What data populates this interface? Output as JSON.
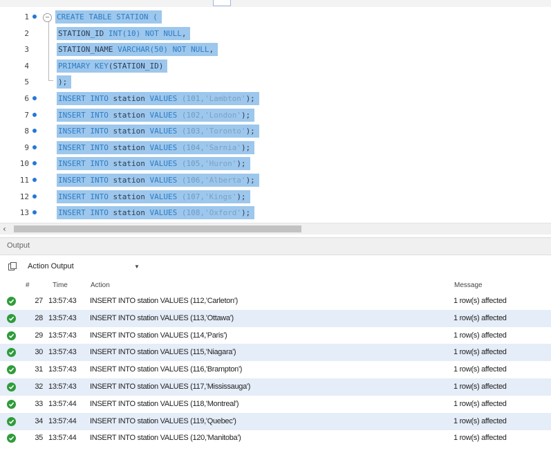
{
  "editor": {
    "lines": [
      {
        "number": "1",
        "breakpoint": true,
        "indent": false,
        "tokens": [
          {
            "t": "CREATE TABLE STATION (",
            "c": "kw"
          }
        ]
      },
      {
        "number": "2",
        "breakpoint": false,
        "indent": true,
        "tokens": [
          {
            "t": "STATION_ID ",
            "c": "plain"
          },
          {
            "t": "INT(10) NOT NULL",
            "c": "kw"
          },
          {
            "t": ",",
            "c": "plain"
          }
        ]
      },
      {
        "number": "3",
        "breakpoint": false,
        "indent": true,
        "tokens": [
          {
            "t": "STATION_NAME ",
            "c": "plain"
          },
          {
            "t": "VARCHAR(50) NOT NULL",
            "c": "kw"
          },
          {
            "t": ",",
            "c": "plain"
          }
        ]
      },
      {
        "number": "4",
        "breakpoint": false,
        "indent": true,
        "tokens": [
          {
            "t": "PRIMARY KEY",
            "c": "kw"
          },
          {
            "t": "(STATION_ID)",
            "c": "plain"
          }
        ]
      },
      {
        "number": "5",
        "breakpoint": false,
        "indent": true,
        "tokens": [
          {
            "t": ");",
            "c": "plain"
          }
        ]
      },
      {
        "number": "6",
        "breakpoint": true,
        "indent": true,
        "tokens": [
          {
            "t": "INSERT INTO ",
            "c": "kw"
          },
          {
            "t": "station ",
            "c": "plain"
          },
          {
            "t": "VALUES ",
            "c": "kw"
          },
          {
            "t": "(101,",
            "c": "num"
          },
          {
            "t": "'Lambton'",
            "c": "str"
          },
          {
            "t": ");",
            "c": "plain"
          }
        ]
      },
      {
        "number": "7",
        "breakpoint": true,
        "indent": true,
        "tokens": [
          {
            "t": "INSERT INTO ",
            "c": "kw"
          },
          {
            "t": "station ",
            "c": "plain"
          },
          {
            "t": "VALUES ",
            "c": "kw"
          },
          {
            "t": "(102,",
            "c": "num"
          },
          {
            "t": "'London'",
            "c": "str"
          },
          {
            "t": ");",
            "c": "plain"
          }
        ]
      },
      {
        "number": "8",
        "breakpoint": true,
        "indent": true,
        "tokens": [
          {
            "t": "INSERT INTO ",
            "c": "kw"
          },
          {
            "t": "station ",
            "c": "plain"
          },
          {
            "t": "VALUES ",
            "c": "kw"
          },
          {
            "t": "(103,",
            "c": "num"
          },
          {
            "t": "'Toronto'",
            "c": "str"
          },
          {
            "t": ");",
            "c": "plain"
          }
        ]
      },
      {
        "number": "9",
        "breakpoint": true,
        "indent": true,
        "tokens": [
          {
            "t": "INSERT INTO ",
            "c": "kw"
          },
          {
            "t": "station ",
            "c": "plain"
          },
          {
            "t": "VALUES ",
            "c": "kw"
          },
          {
            "t": "(104,",
            "c": "num"
          },
          {
            "t": "'Sarnia'",
            "c": "str"
          },
          {
            "t": ");",
            "c": "plain"
          }
        ]
      },
      {
        "number": "10",
        "breakpoint": true,
        "indent": true,
        "tokens": [
          {
            "t": "INSERT INTO ",
            "c": "kw"
          },
          {
            "t": "station ",
            "c": "plain"
          },
          {
            "t": "VALUES ",
            "c": "kw"
          },
          {
            "t": "(105,",
            "c": "num"
          },
          {
            "t": "'Huron'",
            "c": "str"
          },
          {
            "t": ");",
            "c": "plain"
          }
        ]
      },
      {
        "number": "11",
        "breakpoint": true,
        "indent": true,
        "tokens": [
          {
            "t": "INSERT INTO ",
            "c": "kw"
          },
          {
            "t": "station ",
            "c": "plain"
          },
          {
            "t": "VALUES ",
            "c": "kw"
          },
          {
            "t": "(106,",
            "c": "num"
          },
          {
            "t": "'Alberta'",
            "c": "str"
          },
          {
            "t": ");",
            "c": "plain"
          }
        ]
      },
      {
        "number": "12",
        "breakpoint": true,
        "indent": true,
        "tokens": [
          {
            "t": "INSERT INTO ",
            "c": "kw"
          },
          {
            "t": "station ",
            "c": "plain"
          },
          {
            "t": "VALUES ",
            "c": "kw"
          },
          {
            "t": "(107,",
            "c": "num"
          },
          {
            "t": "'Kings'",
            "c": "str"
          },
          {
            "t": ");",
            "c": "plain"
          }
        ]
      },
      {
        "number": "13",
        "breakpoint": true,
        "indent": true,
        "tokens": [
          {
            "t": "INSERT INTO ",
            "c": "kw"
          },
          {
            "t": "station ",
            "c": "plain"
          },
          {
            "t": "VALUES ",
            "c": "kw"
          },
          {
            "t": "(108,",
            "c": "num"
          },
          {
            "t": "'Oxford'",
            "c": "str"
          },
          {
            "t": ");",
            "c": "plain"
          }
        ]
      }
    ]
  },
  "output": {
    "title": "Output",
    "dropdown_value": "Action Output",
    "columns": {
      "num": "#",
      "time": "Time",
      "action": "Action",
      "message": "Message"
    },
    "rows": [
      {
        "num": "27",
        "time": "13:57:43",
        "action": "INSERT INTO station VALUES (112,'Carleton')",
        "message": "1 row(s) affected"
      },
      {
        "num": "28",
        "time": "13:57:43",
        "action": "INSERT INTO station VALUES (113,'Ottawa')",
        "message": "1 row(s) affected"
      },
      {
        "num": "29",
        "time": "13:57:43",
        "action": "INSERT INTO station VALUES (114,'Paris')",
        "message": "1 row(s) affected"
      },
      {
        "num": "30",
        "time": "13:57:43",
        "action": "INSERT INTO station VALUES (115,'Niagara')",
        "message": "1 row(s) affected"
      },
      {
        "num": "31",
        "time": "13:57:43",
        "action": "INSERT INTO station VALUES (116,'Brampton')",
        "message": "1 row(s) affected"
      },
      {
        "num": "32",
        "time": "13:57:43",
        "action": "INSERT INTO station VALUES (117,'Mississauga')",
        "message": "1 row(s) affected"
      },
      {
        "num": "33",
        "time": "13:57:44",
        "action": "INSERT INTO station VALUES (118,'Montreal')",
        "message": "1 row(s) affected"
      },
      {
        "num": "34",
        "time": "13:57:44",
        "action": "INSERT INTO station VALUES (119,'Quebec')",
        "message": "1 row(s) affected"
      },
      {
        "num": "35",
        "time": "13:57:44",
        "action": "INSERT INTO station VALUES (120,'Manitoba')",
        "message": "1 row(s) affected"
      }
    ],
    "icons": {
      "row_status": "success-check-icon",
      "copy": "copy-icon"
    },
    "colors": {
      "success": "#2e9c3a",
      "selection": "#9dc7ec",
      "row_alt": "#e5edf8",
      "keyword": "#2e7cc4"
    }
  }
}
